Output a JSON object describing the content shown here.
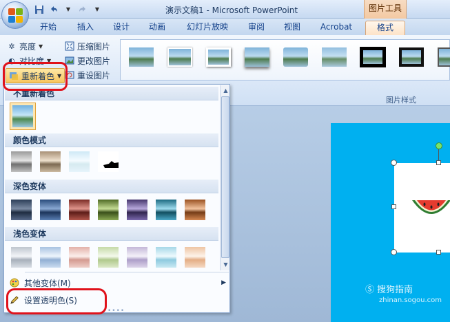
{
  "window": {
    "title": "演示文稿1 - Microsoft PowerPoint",
    "context_tab_group": "图片工具"
  },
  "quick_access": {
    "icons": [
      "save-icon",
      "undo-icon",
      "redo-icon",
      "customize-icon"
    ]
  },
  "tabs": [
    {
      "label": "开始",
      "active": false
    },
    {
      "label": "插入",
      "active": false
    },
    {
      "label": "设计",
      "active": false
    },
    {
      "label": "动画",
      "active": false
    },
    {
      "label": "幻灯片放映",
      "active": false
    },
    {
      "label": "审阅",
      "active": false
    },
    {
      "label": "视图",
      "active": false
    },
    {
      "label": "Acrobat",
      "active": false
    },
    {
      "label": "格式",
      "active": true
    }
  ],
  "ribbon": {
    "adjust": {
      "brightness": "亮度",
      "contrast": "对比度",
      "recolor": "重新着色",
      "compress": "压缩图片",
      "change_picture": "更改图片",
      "reset_picture": "重设图片"
    },
    "picture_styles_label": "图片样式"
  },
  "recolor_menu": {
    "no_recolor": "不重新着色",
    "color_modes": "颜色模式",
    "dark_variations": "深色变体",
    "light_variations": "浅色变体",
    "more_variations": "其他变体(M)",
    "set_transparent_color": "设置透明色(S)"
  },
  "colors": {
    "accent_orange": "#f8c55c",
    "highlight_red": "#e0121b",
    "slide_blue": "#00b0f0",
    "dark_variants": [
      "#3b5f8c",
      "#3e6ea8",
      "#b84a3f",
      "#7f9c3e",
      "#6b569b",
      "#2e9ab7",
      "#d2793a"
    ],
    "light_variants": [
      "#c3ccd6",
      "#b9cfe6",
      "#e8bdb6",
      "#cfe0b4",
      "#cdc3de",
      "#b4e0ec",
      "#f2cfb3"
    ]
  },
  "watermark": {
    "brand": "搜狗指南",
    "url": "zhinan.sogou.com"
  }
}
